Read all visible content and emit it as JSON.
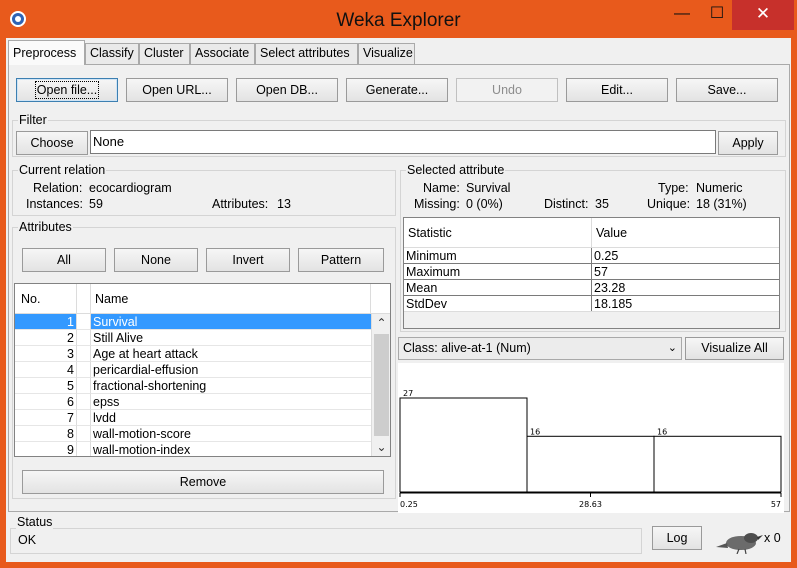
{
  "window": {
    "title": "Weka Explorer",
    "minimize_glyph": "—",
    "maximize_glyph": "☐",
    "close_glyph": "✕"
  },
  "tabs": [
    "Preprocess",
    "Classify",
    "Cluster",
    "Associate",
    "Select attributes",
    "Visualize"
  ],
  "toolbar": {
    "open_file": "Open file...",
    "open_url": "Open URL...",
    "open_db": "Open DB...",
    "generate": "Generate...",
    "undo": "Undo",
    "edit": "Edit...",
    "save": "Save..."
  },
  "filter": {
    "label": "Filter",
    "choose": "Choose",
    "value": "None",
    "apply": "Apply"
  },
  "current_relation": {
    "title": "Current relation",
    "relation_label": "Relation:",
    "relation_value": "ecocardiogram",
    "instances_label": "Instances:",
    "instances_value": "59",
    "attributes_label": "Attributes:",
    "attributes_value": "13"
  },
  "attributes": {
    "title": "Attributes",
    "buttons": {
      "all": "All",
      "none": "None",
      "invert": "Invert",
      "pattern": "Pattern"
    },
    "col_no": "No.",
    "col_name": "Name",
    "rows": [
      {
        "no": "1",
        "name": "Survival"
      },
      {
        "no": "2",
        "name": "Still Alive"
      },
      {
        "no": "3",
        "name": "Age at heart attack"
      },
      {
        "no": "4",
        "name": "pericardial-effusion"
      },
      {
        "no": "5",
        "name": "fractional-shortening"
      },
      {
        "no": "6",
        "name": "epss"
      },
      {
        "no": "7",
        "name": "lvdd"
      },
      {
        "no": "8",
        "name": "wall-motion-score"
      },
      {
        "no": "9",
        "name": "wall-motion-index"
      }
    ],
    "selected_index": 0,
    "remove": "Remove"
  },
  "selected_attribute": {
    "title": "Selected attribute",
    "name_label": "Name:",
    "name_value": "Survival",
    "type_label": "Type:",
    "type_value": "Numeric",
    "missing_label": "Missing:",
    "missing_value": "0 (0%)",
    "distinct_label": "Distinct:",
    "distinct_value": "35",
    "unique_label": "Unique:",
    "unique_value": "18 (31%)",
    "stats_header": {
      "statistic": "Statistic",
      "value": "Value"
    },
    "stats": [
      {
        "name": "Minimum",
        "value": "0.25"
      },
      {
        "name": "Maximum",
        "value": "57"
      },
      {
        "name": "Mean",
        "value": "23.28"
      },
      {
        "name": "StdDev",
        "value": "18.185"
      }
    ]
  },
  "class_selector": {
    "value": "Class: alive-at-1 (Num)",
    "visualize_all": "Visualize All"
  },
  "chart_data": {
    "type": "bar",
    "bins": [
      "0.25–19.17",
      "19.17–38.08",
      "38.08–57"
    ],
    "values": [
      27,
      16,
      16
    ],
    "value_labels": [
      "27",
      "16",
      "16"
    ],
    "x_tick_labels": [
      "0.25",
      "28.63",
      "57"
    ],
    "xlim": [
      0.25,
      57
    ],
    "ylim": [
      0,
      27
    ],
    "bar_color": "#ffffff",
    "edge_color": "#000000"
  },
  "status": {
    "title": "Status",
    "text": "OK",
    "log": "Log",
    "tasks": "x 0"
  },
  "colors": {
    "titlebar": "#e85a1c",
    "close_button": "#c7302b",
    "selection": "#3399ff"
  }
}
